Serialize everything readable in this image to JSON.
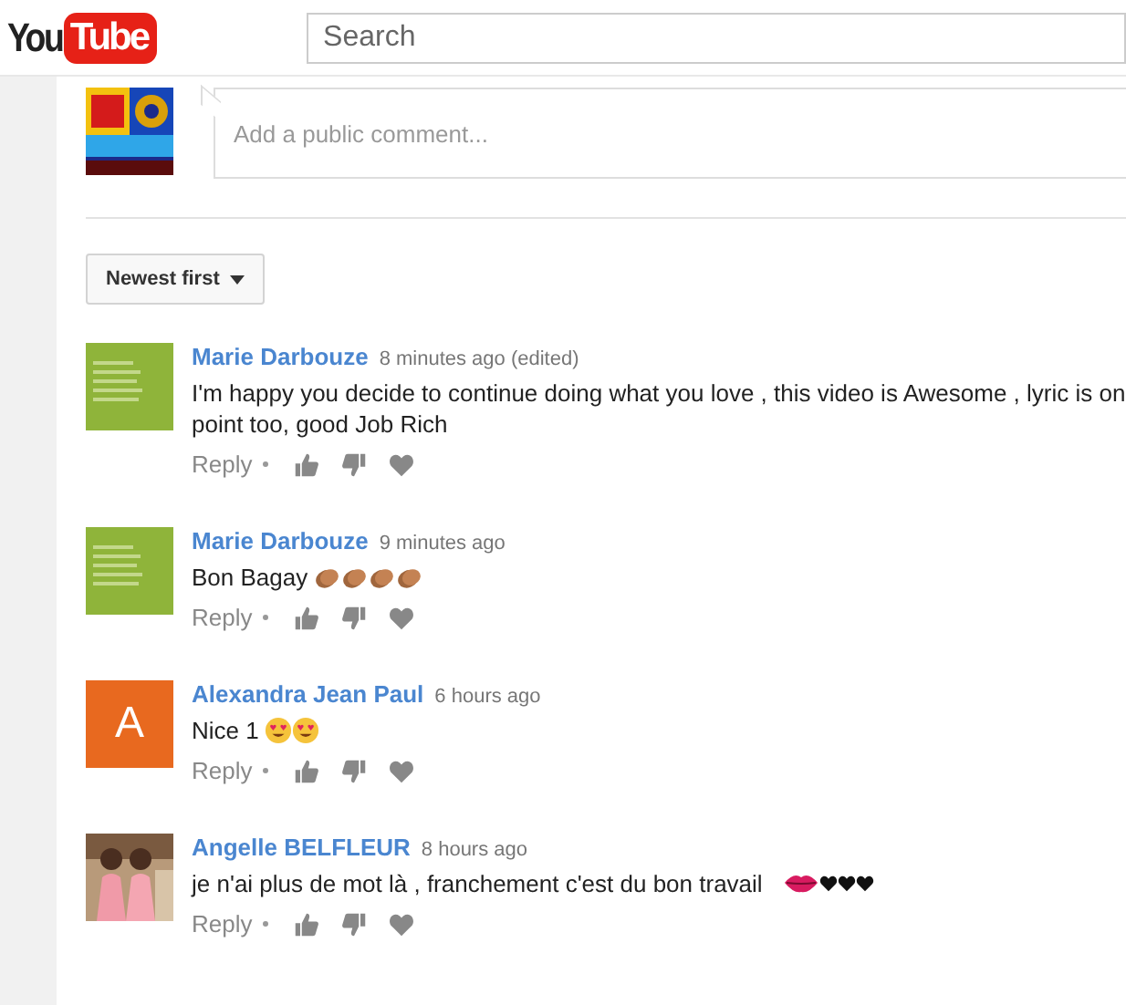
{
  "header": {
    "logo": {
      "you": "You",
      "tube": "Tube"
    },
    "search": {
      "placeholder": "Search"
    }
  },
  "comment_box": {
    "placeholder": "Add a public comment..."
  },
  "sort": {
    "label": "Newest first"
  },
  "comments": [
    {
      "author": "Marie Darbouze",
      "time": "8 minutes ago (edited)",
      "kind": "picture",
      "text": "I'm happy you decide to continue doing what you love , this video is Awesome , lyric is on point too, good Job Rich",
      "reply": "Reply"
    },
    {
      "author": "Marie Darbouze",
      "time": "9 minutes ago",
      "kind": "picture",
      "text": "Bon Bagay",
      "emojis": [
        {
          "kind": "clap"
        },
        {
          "kind": "clap"
        },
        {
          "kind": "clap"
        },
        {
          "kind": "clap"
        }
      ],
      "reply": "Reply"
    },
    {
      "author": "Alexandra Jean Paul",
      "time": "6 hours ago",
      "kind": "letter",
      "initial": "A",
      "color": "#e8691f",
      "text": "Nice 1",
      "emojis": [
        {
          "kind": "heart-eyes"
        },
        {
          "kind": "heart-eyes"
        }
      ],
      "reply": "Reply"
    },
    {
      "author": "Angelle BELFLEUR",
      "time": "8 hours ago",
      "text": "je n'ai plus de mot là , franchement c'est du bon travail",
      "emojis": [
        {
          "kind": "lips"
        },
        {
          "kind": "heart"
        },
        {
          "kind": "heart"
        },
        {
          "kind": "heart"
        }
      ],
      "reply": "Reply"
    }
  ]
}
